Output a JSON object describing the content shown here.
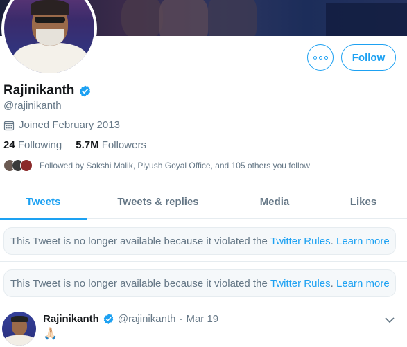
{
  "profile": {
    "name": "Rajinikanth",
    "handle": "@rajinikanth",
    "joined": "Joined February 2013",
    "following_count": "24",
    "following_label": "Following",
    "followers_count": "5.7M",
    "followers_label": "Followers",
    "followed_by": "Followed by Sakshi Malik, Piyush Goyal Office, and 105 others you follow"
  },
  "actions": {
    "follow_label": "Follow",
    "more_icon": "more-options-icon"
  },
  "tabs": [
    {
      "label": "Tweets",
      "active": true
    },
    {
      "label": "Tweets & replies",
      "active": false
    },
    {
      "label": "Media",
      "active": false
    },
    {
      "label": "Likes",
      "active": false
    }
  ],
  "notices": [
    {
      "text": "This Tweet is no longer available because it violated the ",
      "link1": "Twitter Rules",
      "sep": ". ",
      "link2": "Learn more"
    },
    {
      "text": "This Tweet is no longer available because it violated the ",
      "link1": "Twitter Rules",
      "sep": ". ",
      "link2": "Learn more"
    }
  ],
  "tweet": {
    "name": "Rajinikanth",
    "handle": "@rajinikanth",
    "dot": "·",
    "date": "Mar 19",
    "content": "🙏🏻"
  },
  "colors": {
    "accent": "#1da1f2",
    "muted": "#657786",
    "text": "#14171a"
  }
}
